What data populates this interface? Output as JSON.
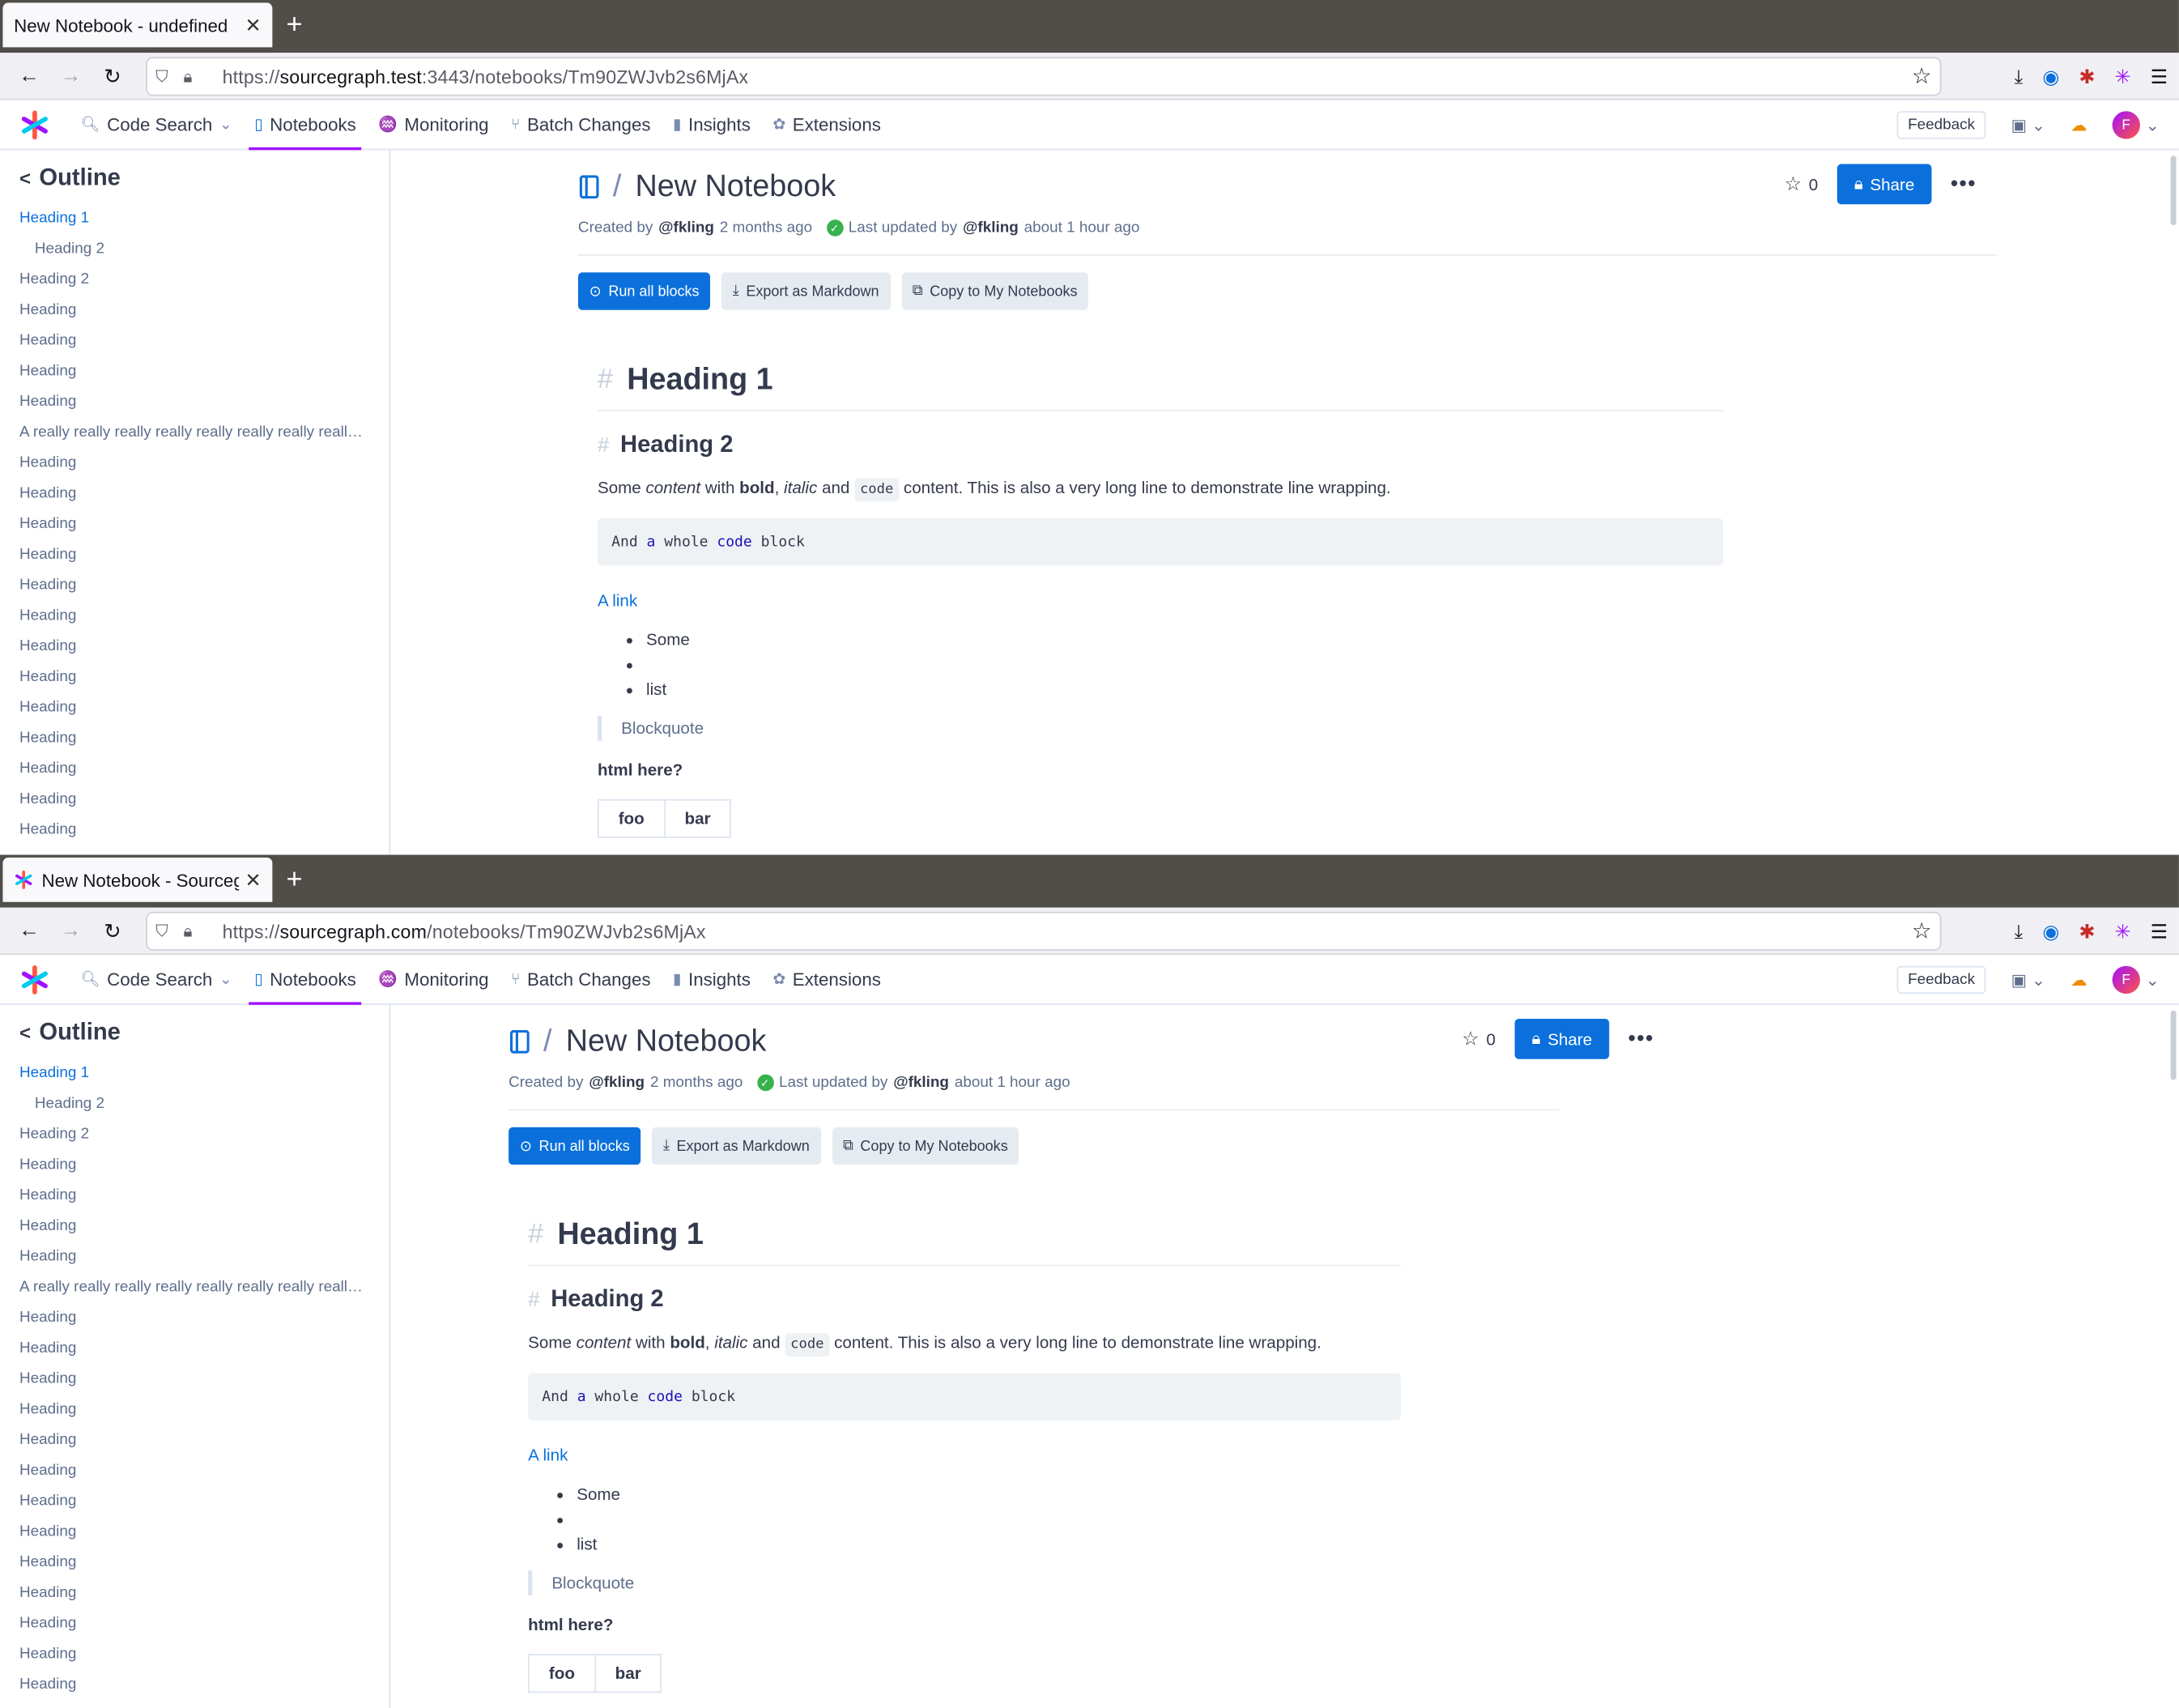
{
  "windows": [
    {
      "tab_title": "New Notebook - undefined",
      "tab_has_favicon": false,
      "url_prefix": "https://",
      "url_host": "sourcegraph.test",
      "url_rest": ":3443/notebooks/Tm90ZWJvb2s6MjAx",
      "layout": "wide"
    },
    {
      "tab_title": "New Notebook - Sourcegraph",
      "tab_has_favicon": true,
      "url_prefix": "https://",
      "url_host": "sourcegraph.com",
      "url_rest": "/notebooks/Tm90ZWJvb2s6MjAx",
      "layout": "narrow"
    }
  ],
  "new_tab_symbol": "+",
  "nav": {
    "items": [
      {
        "label": "Code Search",
        "icon": "search-icon",
        "dropdown": true
      },
      {
        "label": "Notebooks",
        "icon": "notebook-icon",
        "active": true
      },
      {
        "label": "Monitoring",
        "icon": "monitoring-icon"
      },
      {
        "label": "Batch Changes",
        "icon": "batch-changes-icon"
      },
      {
        "label": "Insights",
        "icon": "insights-icon"
      },
      {
        "label": "Extensions",
        "icon": "puzzle-icon"
      }
    ],
    "feedback_label": "Feedback",
    "avatar_initial": "F"
  },
  "outline": {
    "title": "Outline",
    "items": [
      {
        "label": "Heading 1",
        "active": true,
        "sub": false
      },
      {
        "label": "Heading 2",
        "active": false,
        "sub": true
      },
      {
        "label": "Heading 2",
        "active": false,
        "sub": false
      },
      {
        "label": "Heading"
      },
      {
        "label": "Heading"
      },
      {
        "label": "Heading"
      },
      {
        "label": "Heading"
      },
      {
        "label": "A really really really really really really really really really long heading"
      },
      {
        "label": "Heading"
      },
      {
        "label": "Heading"
      },
      {
        "label": "Heading"
      },
      {
        "label": "Heading"
      },
      {
        "label": "Heading"
      },
      {
        "label": "Heading"
      },
      {
        "label": "Heading"
      },
      {
        "label": "Heading"
      },
      {
        "label": "Heading"
      },
      {
        "label": "Heading"
      },
      {
        "label": "Heading"
      },
      {
        "label": "Heading"
      },
      {
        "label": "Heading"
      }
    ]
  },
  "notebook": {
    "breadcrumb_sep": "/",
    "title": "New Notebook",
    "created_by_prefix": "Created by",
    "author": "@fkling",
    "created_ago": "2 months ago",
    "updated_prefix": "Last updated by",
    "updated_by": "@fkling",
    "updated_ago": "about 1 hour ago",
    "star_count": "0",
    "share_label": "Share",
    "more_label": "•••",
    "buttons": {
      "run_all": "Run all blocks",
      "export": "Export as Markdown",
      "copy": "Copy to My Notebooks"
    }
  },
  "markdown": {
    "hash": "#",
    "h1": "Heading 1",
    "h2": "Heading 2",
    "para": {
      "t1": "Some ",
      "em1": "content",
      "t2": " with ",
      "b1": "bold",
      "t3": ", ",
      "em2": "italic",
      "t4": " and ",
      "code": "code",
      "t5": " content. This is also a very long line to demonstrate line wrapping."
    },
    "codeblock": {
      "w1": "And ",
      "w2": "a",
      "w3": " whole ",
      "w4": "code",
      "w5": " block"
    },
    "link": "A link",
    "list": [
      "Some",
      "",
      "list"
    ],
    "blockquote": "Blockquote",
    "html_here": "html here?",
    "table": [
      "foo",
      "bar"
    ]
  }
}
